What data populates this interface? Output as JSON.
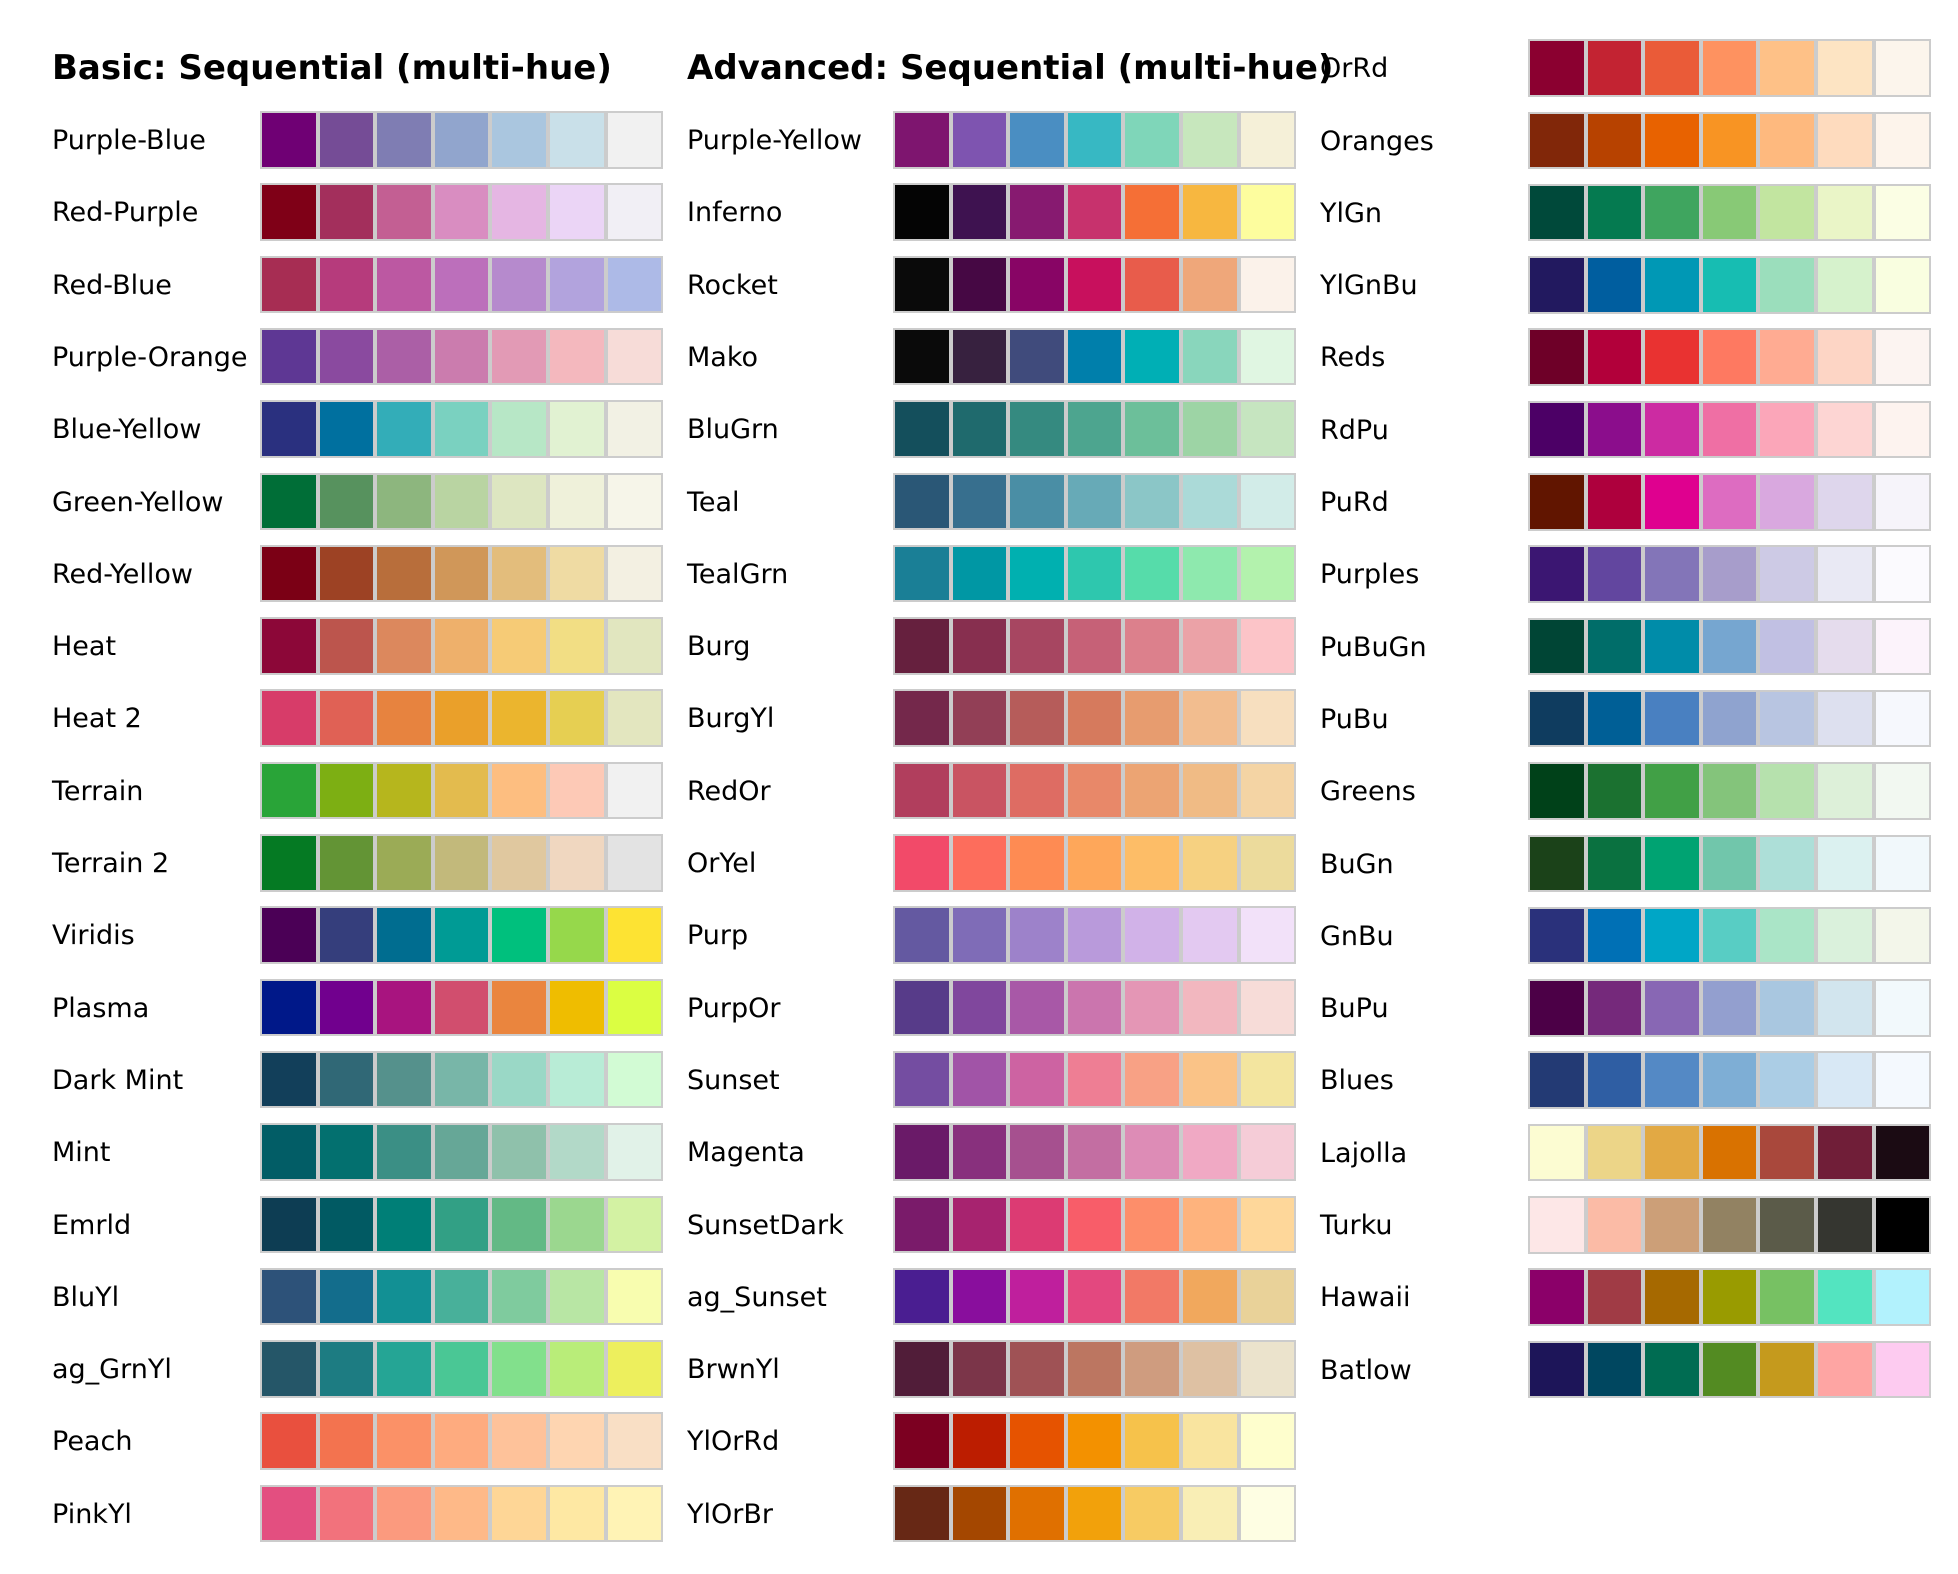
{
  "columns": [
    {
      "title": "Basic: Sequential (multi-hue)",
      "palettes": [
        {
          "name": "Purple-Blue",
          "colors": [
            "#6f0074",
            "#754c96",
            "#7f7db3",
            "#91a5cd",
            "#aac6df",
            "#c9e0e9",
            "#f1f1f1"
          ]
        },
        {
          "name": "Red-Purple",
          "colors": [
            "#7f0017",
            "#a32f5c",
            "#c35f93",
            "#d98dc1",
            "#e5b6e3",
            "#ebd5f6",
            "#f1eff5"
          ]
        },
        {
          "name": "Red-Blue",
          "colors": [
            "#a72d53",
            "#b63b7c",
            "#bc58a2",
            "#bc6fbb",
            "#b68acd",
            "#b2a3dd",
            "#adbae7"
          ]
        },
        {
          "name": "Purple-Orange",
          "colors": [
            "#5e3794",
            "#8a4a9f",
            "#ab5fa6",
            "#cb7cae",
            "#e29ab5",
            "#f4b8be",
            "#f7dcd8"
          ]
        },
        {
          "name": "Blue-Yellow",
          "colors": [
            "#2a307f",
            "#00709f",
            "#33adb8",
            "#7ad1c0",
            "#b7e7c6",
            "#e1f2d2",
            "#f2f1e4"
          ]
        },
        {
          "name": "Green-Yellow",
          "colors": [
            "#006e37",
            "#57925e",
            "#8db67e",
            "#b9d4a2",
            "#dde6c1",
            "#eff1da",
            "#f6f5e9"
          ]
        },
        {
          "name": "Red-Yellow",
          "colors": [
            "#7b0015",
            "#9d4224",
            "#b86e3b",
            "#d09759",
            "#e3bd7c",
            "#efdba3",
            "#f3f0e2"
          ]
        },
        {
          "name": "Heat",
          "colors": [
            "#8c0738",
            "#bc554d",
            "#dc885d",
            "#eeb06b",
            "#f6cb76",
            "#f2de84",
            "#e1e6bf"
          ]
        },
        {
          "name": "Heat 2",
          "colors": [
            "#d73c69",
            "#e06155",
            "#e7833f",
            "#eaa02a",
            "#ebb52e",
            "#e6cf52",
            "#e3e6bf"
          ]
        },
        {
          "name": "Terrain",
          "colors": [
            "#29a438",
            "#7daf13",
            "#b6b61d",
            "#e3bb4e",
            "#fdbe80",
            "#fdc9b6",
            "#f1f1f1"
          ]
        },
        {
          "name": "Terrain 2",
          "colors": [
            "#057a23",
            "#639435",
            "#9bab56",
            "#c2b97b",
            "#e0c89f",
            "#f0d7c0",
            "#e3e3e3"
          ]
        },
        {
          "name": "Viridis",
          "colors": [
            "#4b0056",
            "#353e7c",
            "#006d90",
            "#009b95",
            "#00c07d",
            "#96d84b",
            "#fde333"
          ]
        },
        {
          "name": "Plasma",
          "colors": [
            "#001889",
            "#71008e",
            "#a8147f",
            "#d14e6e",
            "#ea853e",
            "#efbd00",
            "#dbfe42"
          ]
        },
        {
          "name": "Dark Mint",
          "colors": [
            "#123f5a",
            "#306876",
            "#55918c",
            "#78b6a8",
            "#9ad8c6",
            "#b8ecd6",
            "#d2fbd4"
          ]
        },
        {
          "name": "Mint",
          "colors": [
            "#025d66",
            "#03706f",
            "#3b8f85",
            "#66a797",
            "#8fc1ab",
            "#b2d9c8",
            "#e1f2e8"
          ]
        },
        {
          "name": "Emrld",
          "colors": [
            "#0d3d53",
            "#015a63",
            "#007f77",
            "#32a085",
            "#63b985",
            "#9bd78f",
            "#d3f2a3"
          ]
        },
        {
          "name": "BluYl",
          "colors": [
            "#2d5279",
            "#136d8c",
            "#129094",
            "#48b09a",
            "#7fcb9e",
            "#b8e6a4",
            "#f8fdaf"
          ]
        },
        {
          "name": "ag_GrnYl",
          "colors": [
            "#255668",
            "#1d7c82",
            "#25a595",
            "#4ac795",
            "#82e08c",
            "#b9ed79",
            "#edef5d"
          ]
        },
        {
          "name": "Peach",
          "colors": [
            "#e9503e",
            "#f3734f",
            "#fb9167",
            "#feab7f",
            "#fec29a",
            "#fed5b1",
            "#f9dfc5"
          ]
        },
        {
          "name": "PinkYl",
          "colors": [
            "#e34f80",
            "#f2727c",
            "#fb9a7e",
            "#feb988",
            "#fed696",
            "#fee8a3",
            "#fff3b5"
          ]
        }
      ]
    },
    {
      "title": "Advanced: Sequential (multi-hue)",
      "palettes": [
        {
          "name": "Purple-Yellow",
          "colors": [
            "#7e156f",
            "#7e54b0",
            "#4a8ec2",
            "#37b8c3",
            "#7fd6b9",
            "#c7e7bd",
            "#f5f0d8"
          ]
        },
        {
          "name": "Inferno",
          "colors": [
            "#040404",
            "#3e1250",
            "#871a70",
            "#c7326d",
            "#f56f36",
            "#f7b740",
            "#fdfd9e"
          ]
        },
        {
          "name": "Rocket",
          "colors": [
            "#0a0a0a",
            "#460844",
            "#880565",
            "#c8105d",
            "#e85c4b",
            "#efa77a",
            "#fbf2ea"
          ]
        },
        {
          "name": "Mako",
          "colors": [
            "#0a0a0a",
            "#37213f",
            "#404b7c",
            "#007fab",
            "#00afb5",
            "#89d6bc",
            "#e0f6e2"
          ]
        },
        {
          "name": "BluGrn",
          "colors": [
            "#144f5c",
            "#1f6a6d",
            "#358a80",
            "#4da58f",
            "#6cbf9a",
            "#9dd4a5",
            "#c6e5c0"
          ]
        },
        {
          "name": "Teal",
          "colors": [
            "#2a5776",
            "#376f8e",
            "#4a8ea5",
            "#67aab7",
            "#8bc6c7",
            "#abdad8",
            "#d2ece8"
          ]
        },
        {
          "name": "TealGrn",
          "colors": [
            "#1a7f96",
            "#0097a4",
            "#00b0b0",
            "#2ec7ae",
            "#56dcaa",
            "#8ee9ae",
            "#b3f2ad"
          ]
        },
        {
          "name": "Burg",
          "colors": [
            "#66203e",
            "#872f4f",
            "#a74661",
            "#c66177",
            "#dc808c",
            "#eba2a7",
            "#fcc4c8"
          ]
        },
        {
          "name": "BurgYl",
          "colors": [
            "#74284b",
            "#923f56",
            "#b65c5a",
            "#d67a5d",
            "#e79c6f",
            "#f2bd8f",
            "#f7dfbf"
          ]
        },
        {
          "name": "RedOr",
          "colors": [
            "#b13e5d",
            "#c95462",
            "#de6c63",
            "#e88869",
            "#eca473",
            "#f0bb85",
            "#f4d4a4"
          ]
        },
        {
          "name": "OrYel",
          "colors": [
            "#f24a69",
            "#fd6d5c",
            "#fe8b53",
            "#fea75a",
            "#fdbd67",
            "#f6d181",
            "#ecdb9c"
          ]
        },
        {
          "name": "Purp",
          "colors": [
            "#6459a1",
            "#7f6cb7",
            "#9d82ca",
            "#b99adb",
            "#d1b2e8",
            "#e3c9f1",
            "#f2e1f9"
          ]
        },
        {
          "name": "PurpOr",
          "colors": [
            "#573b89",
            "#80479d",
            "#a858a7",
            "#cb75ae",
            "#e496b5",
            "#f2b7bf",
            "#f7dcd8"
          ]
        },
        {
          "name": "Sunset",
          "colors": [
            "#744da1",
            "#a154a7",
            "#cd63a2",
            "#ee7e94",
            "#f8a185",
            "#fac387",
            "#f3e59f"
          ]
        },
        {
          "name": "Magenta",
          "colors": [
            "#6a1a68",
            "#88307d",
            "#a6508f",
            "#c36ea2",
            "#dd8cb6",
            "#f0a9c4",
            "#f5ccd7"
          ]
        },
        {
          "name": "SunsetDark",
          "colors": [
            "#7a1b6a",
            "#a7236f",
            "#dc3b73",
            "#f85d69",
            "#fd8e6a",
            "#feb37d",
            "#fed79a"
          ]
        },
        {
          "name": "ag_Sunset",
          "colors": [
            "#4a1e91",
            "#890e9d",
            "#bf1f9d",
            "#e3487f",
            "#f27966",
            "#f1a85d",
            "#e9d299"
          ]
        },
        {
          "name": "BrwnYl",
          "colors": [
            "#511d39",
            "#7b3549",
            "#9f5255",
            "#bc7661",
            "#cf9c7f",
            "#dec1a3",
            "#ebe3cc"
          ]
        },
        {
          "name": "YlOrRd",
          "colors": [
            "#7c0021",
            "#bc1d00",
            "#e65300",
            "#f39100",
            "#f6c24b",
            "#f9e49f",
            "#fefecd"
          ]
        },
        {
          "name": "YlOrBr",
          "colors": [
            "#672815",
            "#a44700",
            "#e07000",
            "#f2a10b",
            "#f7cb63",
            "#f9eeb5",
            "#fefee3"
          ]
        }
      ]
    },
    {
      "title": "",
      "palettes": [
        {
          "name": "OrRd",
          "colors": [
            "#8b0030",
            "#c32332",
            "#ea5b38",
            "#fe9260",
            "#fec187",
            "#fde4c3",
            "#fcf5ec"
          ]
        },
        {
          "name": "Oranges",
          "colors": [
            "#812709",
            "#b74200",
            "#e86200",
            "#f89423",
            "#feb97e",
            "#fedbbe",
            "#fdf4eb"
          ]
        },
        {
          "name": "YlGn",
          "colors": [
            "#00493a",
            "#057a50",
            "#3fa55f",
            "#88c976",
            "#c2e5a0",
            "#eaf5c7",
            "#fbfee4"
          ]
        },
        {
          "name": "YlGnBu",
          "colors": [
            "#22195f",
            "#005e9f",
            "#0098b5",
            "#17bdb2",
            "#9bdebc",
            "#d6f2cc",
            "#f9fee0"
          ]
        },
        {
          "name": "Reds",
          "colors": [
            "#6e0028",
            "#b2003a",
            "#e93231",
            "#fe7961",
            "#ffab92",
            "#fdd5c5",
            "#fcf4f1"
          ]
        },
        {
          "name": "RdPu",
          "colors": [
            "#4c0066",
            "#8b0d8c",
            "#cc2ba2",
            "#ef6fa4",
            "#fba6b9",
            "#fdd5d3",
            "#fdf3ef"
          ]
        },
        {
          "name": "PuRd",
          "colors": [
            "#611500",
            "#ae003d",
            "#df008f",
            "#dd6cc1",
            "#d9a8df",
            "#ded6ec",
            "#f6f4fa"
          ]
        },
        {
          "name": "Purples",
          "colors": [
            "#3b1672",
            "#62469f",
            "#8375b8",
            "#a79dcb",
            "#cdcae5",
            "#e9e9f4",
            "#fbfafe"
          ]
        },
        {
          "name": "PuBuGn",
          "colors": [
            "#004535",
            "#006d69",
            "#008ca9",
            "#76a6d0",
            "#c1c0e3",
            "#e5dced",
            "#fcf3fb"
          ]
        },
        {
          "name": "PuBu",
          "colors": [
            "#0f3c5f",
            "#005f96",
            "#4980c1",
            "#8fa3cf",
            "#b8c5e1",
            "#dde0ef",
            "#f6f8fd"
          ]
        },
        {
          "name": "Greens",
          "colors": [
            "#004119",
            "#1b7130",
            "#41a046",
            "#84c47b",
            "#b6e1ad",
            "#ddf0d9",
            "#f2f8f1"
          ]
        },
        {
          "name": "BuGn",
          "colors": [
            "#1b4219",
            "#0a7140",
            "#00a372",
            "#71c6ab",
            "#addfd8",
            "#dbf1f0",
            "#f1f8fb"
          ]
        },
        {
          "name": "GnBu",
          "colors": [
            "#2a317b",
            "#0070b5",
            "#00a6c6",
            "#58cdc4",
            "#aae5c7",
            "#daf1dc",
            "#f3f6ea"
          ]
        },
        {
          "name": "BuPu",
          "colors": [
            "#4c0047",
            "#75297b",
            "#8867b4",
            "#939fcf",
            "#a9c7e0",
            "#d2e5ee",
            "#f2f9fc"
          ]
        },
        {
          "name": "Blues",
          "colors": [
            "#233a74",
            "#2f5ea3",
            "#5489c5",
            "#7eaed5",
            "#abcde5",
            "#d8e8f5",
            "#f4f9fe"
          ]
        },
        {
          "name": "Lajolla",
          "colors": [
            "#fcfcd2",
            "#ecd588",
            "#e2a944",
            "#d97200",
            "#a9483c",
            "#701e38",
            "#1b0b13"
          ]
        },
        {
          "name": "Turku",
          "colors": [
            "#fde7e7",
            "#fbbba6",
            "#cc9f78",
            "#928262",
            "#5b5b49",
            "#353630",
            "#000000"
          ]
        },
        {
          "name": "Hawaii",
          "colors": [
            "#8b0069",
            "#a03b45",
            "#a66900",
            "#999b00",
            "#77c163",
            "#53e4c0",
            "#b2f2fd"
          ]
        },
        {
          "name": "Batlow",
          "colors": [
            "#1d1559",
            "#004760",
            "#006c52",
            "#538b22",
            "#c59a1d",
            "#fea5a3",
            "#fdcbf0"
          ]
        }
      ]
    }
  ]
}
